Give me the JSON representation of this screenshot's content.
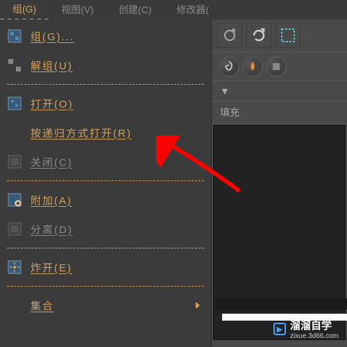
{
  "menubar": {
    "items": [
      {
        "label": "组(G)",
        "active": true
      },
      {
        "label": "视图(V)"
      },
      {
        "label": "创建(C)"
      },
      {
        "label": "修改器("
      }
    ]
  },
  "dropdown": {
    "items": [
      {
        "label": "组(G)...",
        "icon": "group-icon",
        "enabled": true
      },
      {
        "label": "解组(U)",
        "icon": "ungroup-icon",
        "enabled": true
      },
      {
        "separator": true
      },
      {
        "label": "打开(O)",
        "icon": "open-icon",
        "enabled": true
      },
      {
        "label": "按递归方式打开(R)",
        "icon": "",
        "enabled": true
      },
      {
        "label": "关闭(C)",
        "icon": "close-icon",
        "enabled": false
      },
      {
        "separator": true
      },
      {
        "label": "附加(A)",
        "icon": "attach-icon",
        "enabled": true
      },
      {
        "label": "分离(D)",
        "icon": "detach-icon",
        "enabled": false
      },
      {
        "separator": true
      },
      {
        "label": "炸开(E)",
        "icon": "explode-icon",
        "enabled": true
      },
      {
        "separator": true
      },
      {
        "label": "集合",
        "icon": "",
        "enabled": true,
        "submenu": true
      }
    ]
  },
  "section": {
    "label_fill": "填充"
  },
  "watermark": {
    "text": "溜溜自学",
    "url": "zixue.3d66.com"
  }
}
